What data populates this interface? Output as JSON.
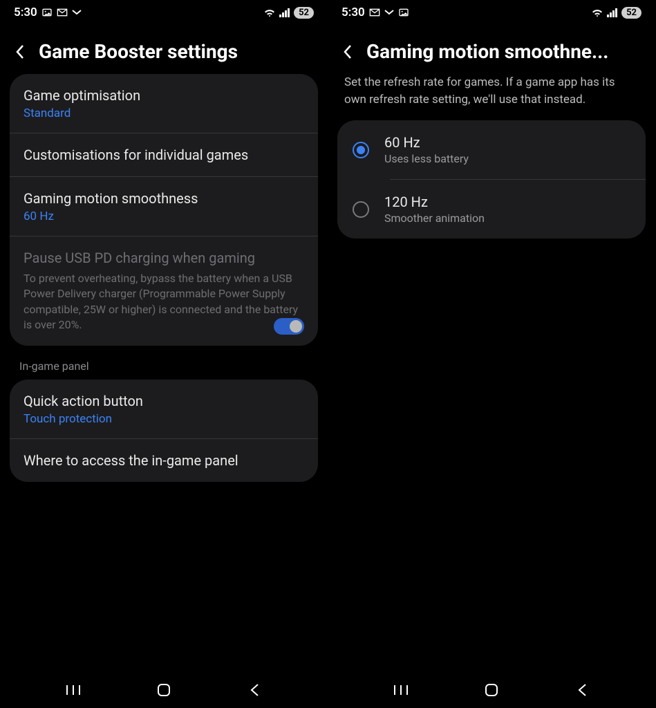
{
  "left": {
    "status": {
      "time": "5:30",
      "battery": "52"
    },
    "header": {
      "title": "Game Booster settings"
    },
    "card1": [
      {
        "title": "Game optimisation",
        "value": "Standard"
      },
      {
        "title": "Customisations for individual games"
      },
      {
        "title": "Gaming motion smoothness",
        "value": "60 Hz"
      },
      {
        "title": "Pause USB PD charging when gaming",
        "desc": "To prevent overheating, bypass the battery when a USB Power Delivery charger (Programmable Power Supply compatible, 25W or higher) is connected and the battery is over 20%.",
        "disabled": true,
        "toggle": true
      }
    ],
    "section2_label": "In-game panel",
    "card2": [
      {
        "title": "Quick action button",
        "value": "Touch protection"
      },
      {
        "title": "Where to access the in-game panel"
      }
    ]
  },
  "right": {
    "status": {
      "time": "5:30",
      "battery": "52"
    },
    "header": {
      "title": "Gaming motion smoothne..."
    },
    "description": "Set the refresh rate for games. If a game app has its own refresh rate setting, we'll use that instead.",
    "options": [
      {
        "title": "60 Hz",
        "sub": "Uses less battery",
        "selected": true
      },
      {
        "title": "120 Hz",
        "sub": "Smoother animation",
        "selected": false
      }
    ]
  }
}
